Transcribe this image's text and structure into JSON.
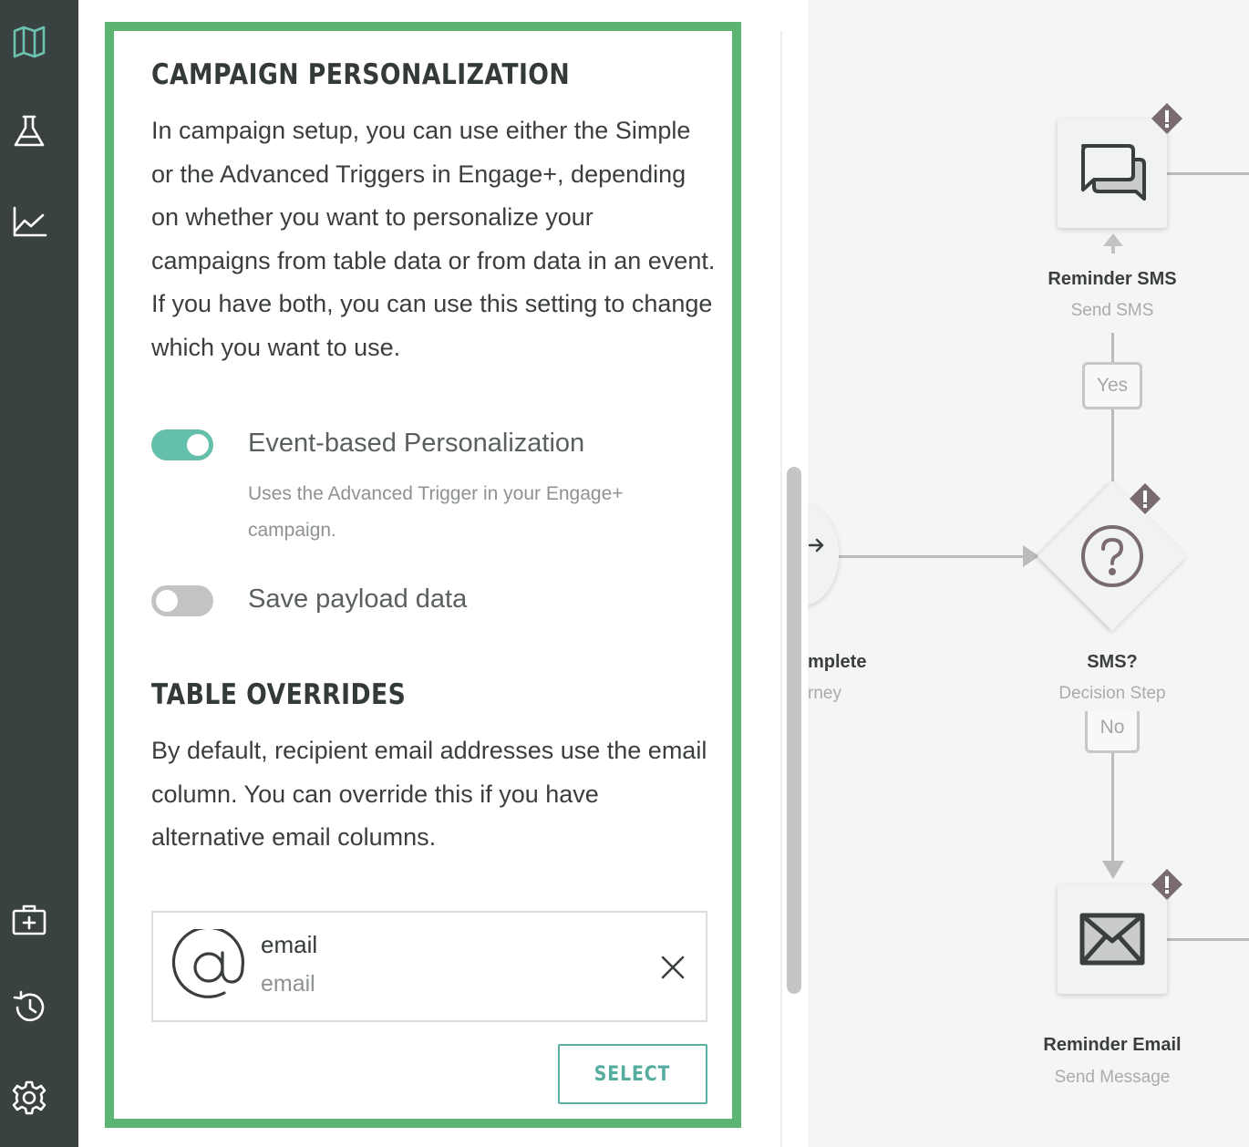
{
  "nav": {
    "items": [
      {
        "name": "map-icon"
      },
      {
        "name": "flask-icon"
      },
      {
        "name": "chart-line-icon"
      },
      {
        "name": "medical-kit-icon"
      },
      {
        "name": "history-icon"
      },
      {
        "name": "gear-icon"
      }
    ]
  },
  "panel": {
    "personalization": {
      "title": "CAMPAIGN PERSONALIZATION",
      "description": "In campaign setup, you can use either the Simple or the Advanced Triggers in Engage+, depending on whether you want to personalize your campaigns from table data or from data in an event. If you have both, you can use this setting to change which you want to use.",
      "event_toggle": {
        "label": "Event-based Personalization",
        "help": "Uses the Advanced Trigger in your Engage+ campaign.",
        "on": true
      },
      "payload_toggle": {
        "label": "Save payload data",
        "on": false
      }
    },
    "overrides": {
      "title": "TABLE OVERRIDES",
      "description": "By default, recipient email addresses use the email column. You can override this if you have alternative email columns.",
      "selected": {
        "name": "email",
        "column": "email"
      },
      "select_label": "SELECT"
    }
  },
  "canvas": {
    "nodes": [
      {
        "title": "Reminder SMS",
        "subtitle": "Send SMS",
        "icon": "chat-bubbles-icon"
      },
      {
        "title": "SMS?",
        "subtitle": "Decision Step",
        "icon": "question-icon"
      },
      {
        "title": "Reminder Email",
        "subtitle": "Send Message",
        "icon": "envelope-icon"
      }
    ],
    "partial_node": {
      "title": "mplete",
      "subtitle": "rney"
    },
    "branches": {
      "yes": "Yes",
      "no": "No"
    },
    "colors": {
      "warning": "#7a6b70",
      "line": "#b9bcbb",
      "accent": "#5bb46f",
      "toggle_on": "#64bfab"
    }
  }
}
